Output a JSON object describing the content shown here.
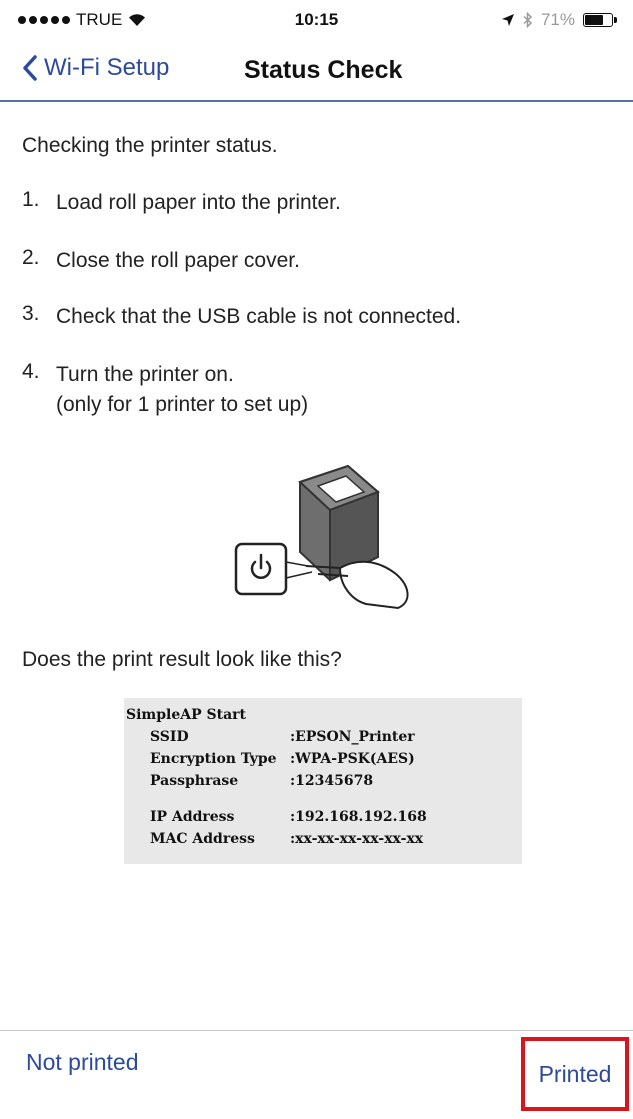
{
  "status_bar": {
    "carrier": "TRUE",
    "time": "10:15",
    "battery": "71%",
    "battery_level": 0.71,
    "icons": [
      "signal-dots",
      "wifi-icon",
      "location-arrow-icon",
      "bluetooth-icon",
      "battery-icon"
    ]
  },
  "nav": {
    "back_label": "Wi-Fi Setup",
    "title": "Status Check"
  },
  "content": {
    "intro": "Checking the printer status.",
    "steps": [
      {
        "num": "1.",
        "text": "Load roll paper into the printer."
      },
      {
        "num": "2.",
        "text": "Close the roll paper cover."
      },
      {
        "num": "3.",
        "text": "Check that the USB cable is not connected."
      },
      {
        "num": "4.",
        "text": "Turn the printer on.",
        "text2": "(only for 1 printer to set up)"
      }
    ],
    "illustration_icon": "printer-power-button-icon",
    "question": "Does the print result look like this?"
  },
  "print_sample": {
    "title": "SimpleAP Start",
    "rows": [
      {
        "key": "SSID",
        "value": ":EPSON_Printer"
      },
      {
        "key": "Encryption Type",
        "value": ":WPA-PSK(AES)"
      },
      {
        "key": "Passphrase",
        "value": ":12345678"
      },
      {
        "key": "IP Address",
        "value": ":192.168.192.168"
      },
      {
        "key": "MAC Address",
        "value": ":xx-xx-xx-xx-xx-xx"
      }
    ]
  },
  "toolbar": {
    "not_printed_label": "Not printed",
    "printed_label": "Printed"
  },
  "colors": {
    "accent": "#2d4a9c",
    "highlight": "#d8141c",
    "nav_border": "#5b6fa6",
    "sample_bg": "#e8e8e8"
  }
}
